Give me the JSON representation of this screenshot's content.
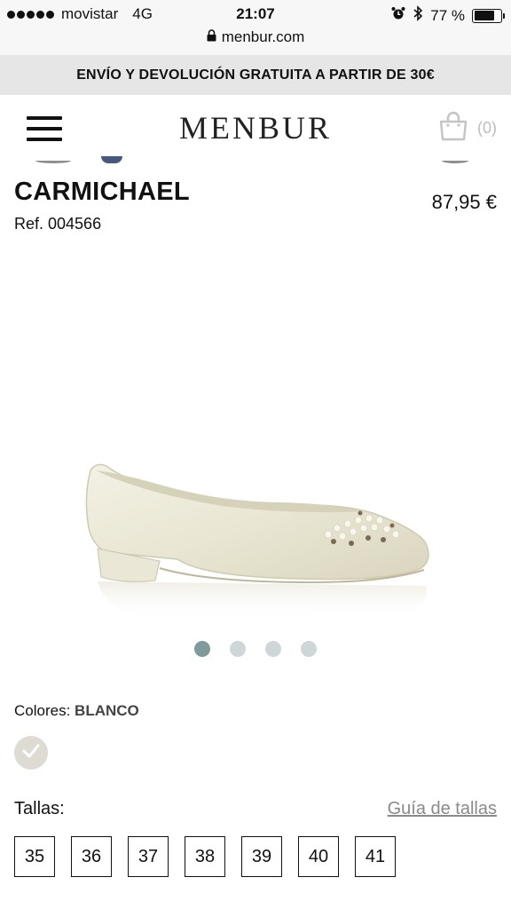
{
  "status_bar": {
    "carrier": "movistar",
    "network": "4G",
    "time": "21:07",
    "battery": "77 %",
    "battery_level": 0.77,
    "url": "menbur.com"
  },
  "promo": {
    "text": "ENVÍO Y DEVOLUCIÓN GRATUITA A PARTIR DE 30€"
  },
  "header": {
    "logo": "MENBUR",
    "cart_count": "(0)"
  },
  "product": {
    "name": "CARMICHAEL",
    "price": "87,95 €",
    "ref": "Ref. 004566",
    "image_pages": 4,
    "active_image": 1
  },
  "colors": {
    "label": "Colores:",
    "selected": "BLANCO"
  },
  "sizes": {
    "label": "Tallas:",
    "guide_link": "Guía de tallas",
    "options": [
      "35",
      "36",
      "37",
      "38",
      "39",
      "40",
      "41"
    ]
  },
  "theme": {
    "dot_active": "#7f9a9a",
    "dot_inactive": "#cfd6d8",
    "promo_bg": "#e6e6e6"
  }
}
